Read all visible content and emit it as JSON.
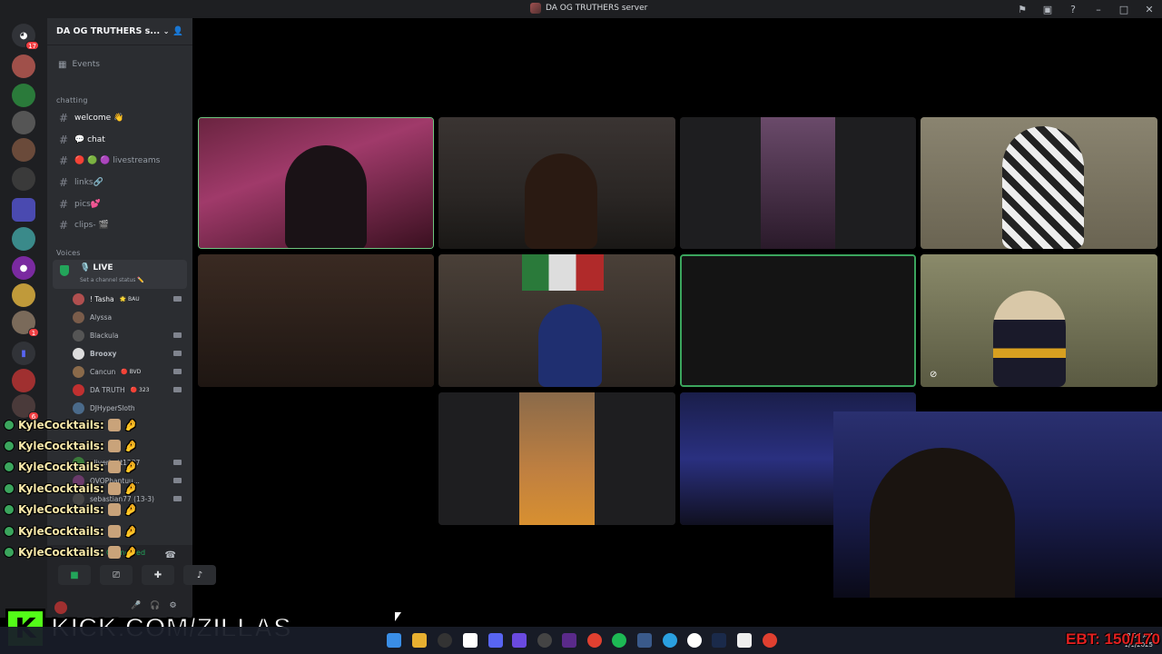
{
  "window": {
    "title": "DA OG TRUTHERS server"
  },
  "titlebar_icons": [
    "inbox-icon",
    "monitor-icon",
    "help-icon",
    "minimize-icon",
    "maximize-icon",
    "close-icon"
  ],
  "rail": {
    "home_badge": "17",
    "badges": [
      "1",
      "6"
    ]
  },
  "sidebar": {
    "server_name": "DA OG TRUTHERS s...",
    "events": "Events",
    "categories": {
      "chatting": "chatting",
      "voices": "Voices"
    },
    "channels": [
      {
        "name": "welcome 👋"
      },
      {
        "name": "💬 chat"
      },
      {
        "name": "🔴 🟢 🟣 livestreams"
      },
      {
        "name": "links🔗"
      },
      {
        "name": "pics💕"
      },
      {
        "name": "clips- 🎬"
      }
    ],
    "voice_channel": {
      "name": "🎙️ LIVE",
      "status": "Set a channel status ✏️"
    },
    "members": [
      {
        "name": "! Tasha",
        "tag": "🌟 BAU",
        "color": "#b04f4f"
      },
      {
        "name": "Alyssa",
        "tag": "",
        "color": "#7a5c4a"
      },
      {
        "name": "Blackula",
        "tag": "",
        "color": "#555"
      },
      {
        "name": "Brooxy",
        "tag": "",
        "color": "#eee"
      },
      {
        "name": "Cancun",
        "tag": "🔴 BVD",
        "color": "#8a6a4a"
      },
      {
        "name": "DA TRUTH",
        "tag": "🔴 323",
        "color": "#c03030"
      },
      {
        "name": "DJHyperSloth",
        "tag": "",
        "color": "#4a6a8a"
      },
      {
        "name": "oliverbatt1287",
        "tag": "",
        "color": "#3a7a3a"
      },
      {
        "name": "OVOPhantuu...",
        "tag": "",
        "color": "#6a3a6a"
      },
      {
        "name": "sebastian77 (13-3)",
        "tag": "",
        "color": "#444"
      }
    ],
    "voice_panel": {
      "status": "Video Connected"
    }
  },
  "chat_overlay": {
    "lines": [
      "KyleCocktails:",
      "KyleCocktails:",
      "KyleCocktails:",
      "KyleCocktails:",
      "KyleCocktails:",
      "KyleCocktails:",
      "KyleCocktails:"
    ]
  },
  "kick_banner": {
    "logo": "K",
    "text": "KICK.COM/ZILLAS"
  },
  "ebt": "EBT: 150/170",
  "taskbar": {
    "time": "2:34 AM",
    "date": "1/1/2025"
  }
}
